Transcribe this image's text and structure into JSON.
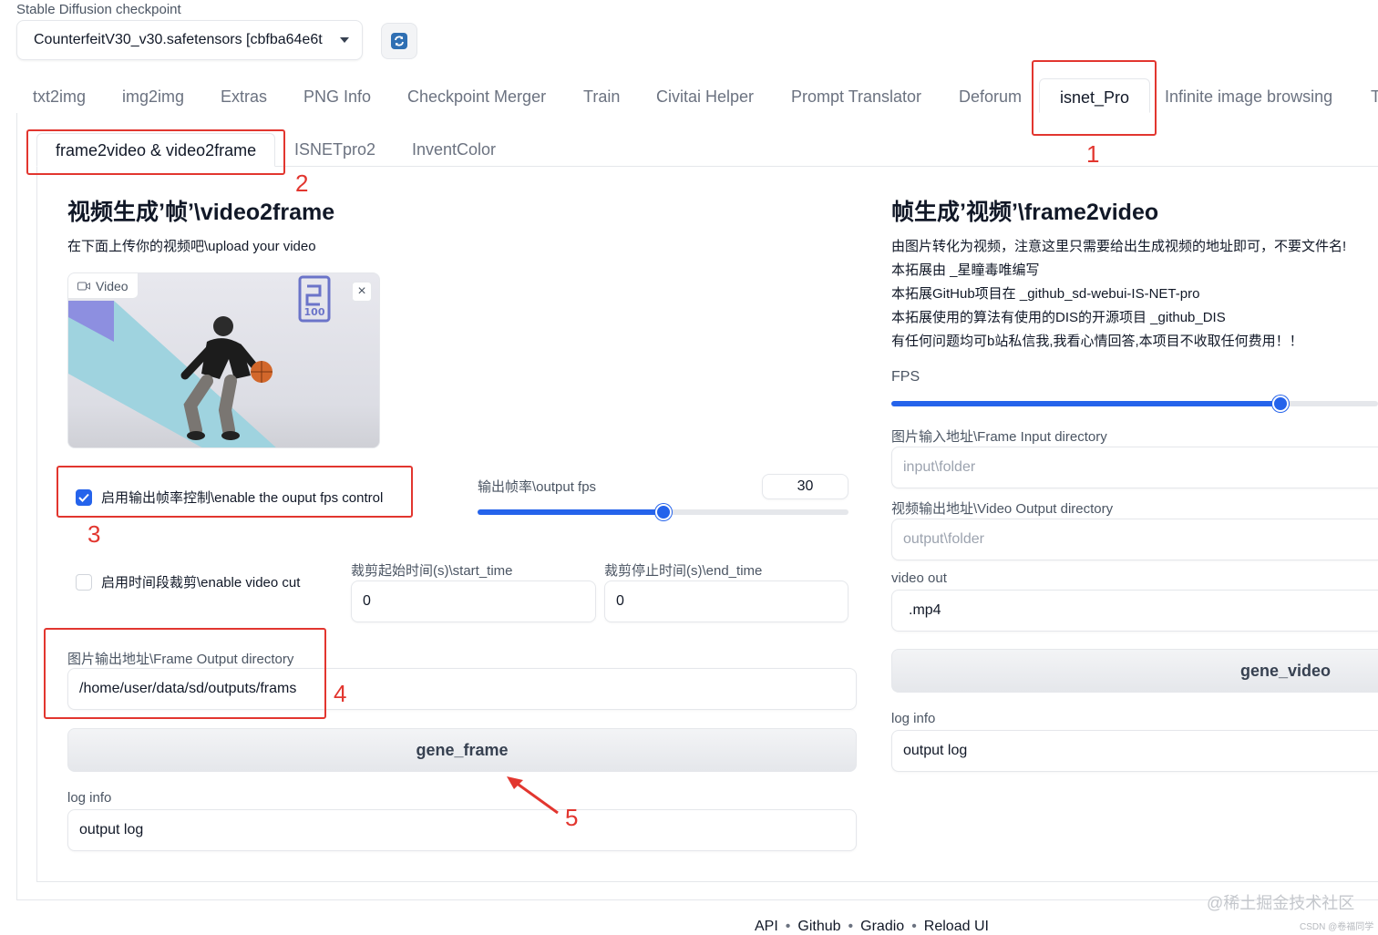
{
  "checkpoint": {
    "label": "Stable Diffusion checkpoint",
    "value": "CounterfeitV30_v30.safetensors [cbfba64e6t"
  },
  "main_tabs": [
    {
      "label": "txt2img"
    },
    {
      "label": "img2img"
    },
    {
      "label": "Extras"
    },
    {
      "label": "PNG Info"
    },
    {
      "label": "Checkpoint Merger"
    },
    {
      "label": "Train"
    },
    {
      "label": "Civitai Helper"
    },
    {
      "label": "Prompt Translator"
    },
    {
      "label": "Deforum"
    },
    {
      "label": "isnet_Pro"
    },
    {
      "label": "Infinite image browsing"
    },
    {
      "label": "T"
    }
  ],
  "sub_tabs": [
    {
      "label": "frame2video & video2frame"
    },
    {
      "label": "ISNETpro2"
    },
    {
      "label": "InventColor"
    }
  ],
  "left": {
    "title": "视频生成’帧’\\video2frame",
    "subtitle": "在下面上传你的视频吧\\upload your video",
    "video_chip": "Video",
    "fps_control_label": "启用输出帧率控制\\enable the ouput fps control",
    "fps_control_checked": true,
    "output_fps_label": "输出帧率\\output fps",
    "output_fps_value": "30",
    "output_fps_slider_fraction": 0.5,
    "video_cut_label": "启用时间段裁剪\\enable video cut",
    "video_cut_checked": false,
    "start_time_label": "裁剪起始时间(s)\\start_time",
    "start_time_value": "0",
    "end_time_label": "裁剪停止时间(s)\\end_time",
    "end_time_value": "0",
    "frame_output_label": "图片输出地址\\Frame Output directory",
    "frame_output_value": "/home/user/data/sd/outputs/frams",
    "gene_frame_label": "gene_frame",
    "log_label": "log info",
    "log_value": "output log"
  },
  "right": {
    "title": "帧生成’视频’\\frame2video",
    "lines": [
      "由图片转化为视频，注意这里只需要给出生成视频的地址即可，不要文件名!",
      "本拓展由 _星瞳毒唯编写",
      "本拓展GitHub项目在 _github_sd-webui-IS-NET-pro",
      "本拓展使用的算法有使用的DIS的开源项目 _github_DIS",
      "有任何问题均可b站私信我,我看心情回答,本项目不收取任何费用！！"
    ],
    "fps_label": "FPS",
    "fps_slider_fraction": 0.8,
    "frame_input_label": "图片输入地址\\Frame Input directory",
    "frame_input_placeholder": "input\\folder",
    "video_output_label": "视频输出地址\\Video Output directory",
    "video_output_placeholder": "output\\folder",
    "video_out_label": "video out",
    "video_out_value": ".mp4",
    "gene_video_label": "gene_video",
    "log_label": "log info",
    "log_value": "output log"
  },
  "annotations": [
    "1",
    "2",
    "3",
    "4",
    "5"
  ],
  "footer": [
    "API",
    "Github",
    "Gradio",
    "Reload UI"
  ],
  "footer_separator": "•",
  "watermark": "@稀土掘金技术社区",
  "watermark_small": "CSDN @卷福同学",
  "colors": {
    "accent": "#2563eb",
    "annotation": "#e2362f"
  }
}
